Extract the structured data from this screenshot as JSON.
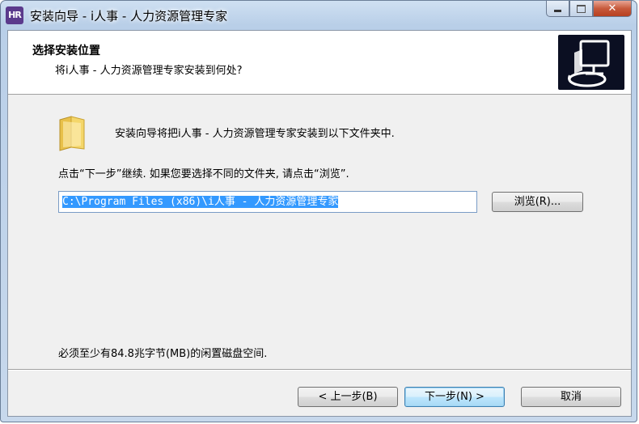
{
  "window": {
    "title": "安装向导 - i人事 - 人力资源管理专家",
    "app_icon_text": "HR",
    "minimize_glyph": "",
    "maximize_glyph": "",
    "close_glyph": "✕"
  },
  "header": {
    "title": "选择安装位置",
    "subtitle": "将i人事 - 人力资源管理专家安装到何处?"
  },
  "body": {
    "intro": "安装向导将把i人事 - 人力资源管理专家安装到以下文件夹中.",
    "hint": "点击“下一步”继续. 如果您要选择不同的文件夹, 请点击“浏览”.",
    "path_value": "C:\\Program Files (x86)\\i人事 - 人力资源管理专家",
    "browse_label": "浏览(R)...",
    "space_note": "必须至少有84.8兆字节(MB)的闲置磁盘空间."
  },
  "footer": {
    "back_label": "< 上一步(B)",
    "next_label": "下一步(N) >",
    "cancel_label": "取消"
  },
  "colors": {
    "selection": "#3399ff",
    "default_button_border": "#3c7fb1",
    "header_image_bg": "#0b0f22",
    "close_button": "#c75a3c"
  }
}
